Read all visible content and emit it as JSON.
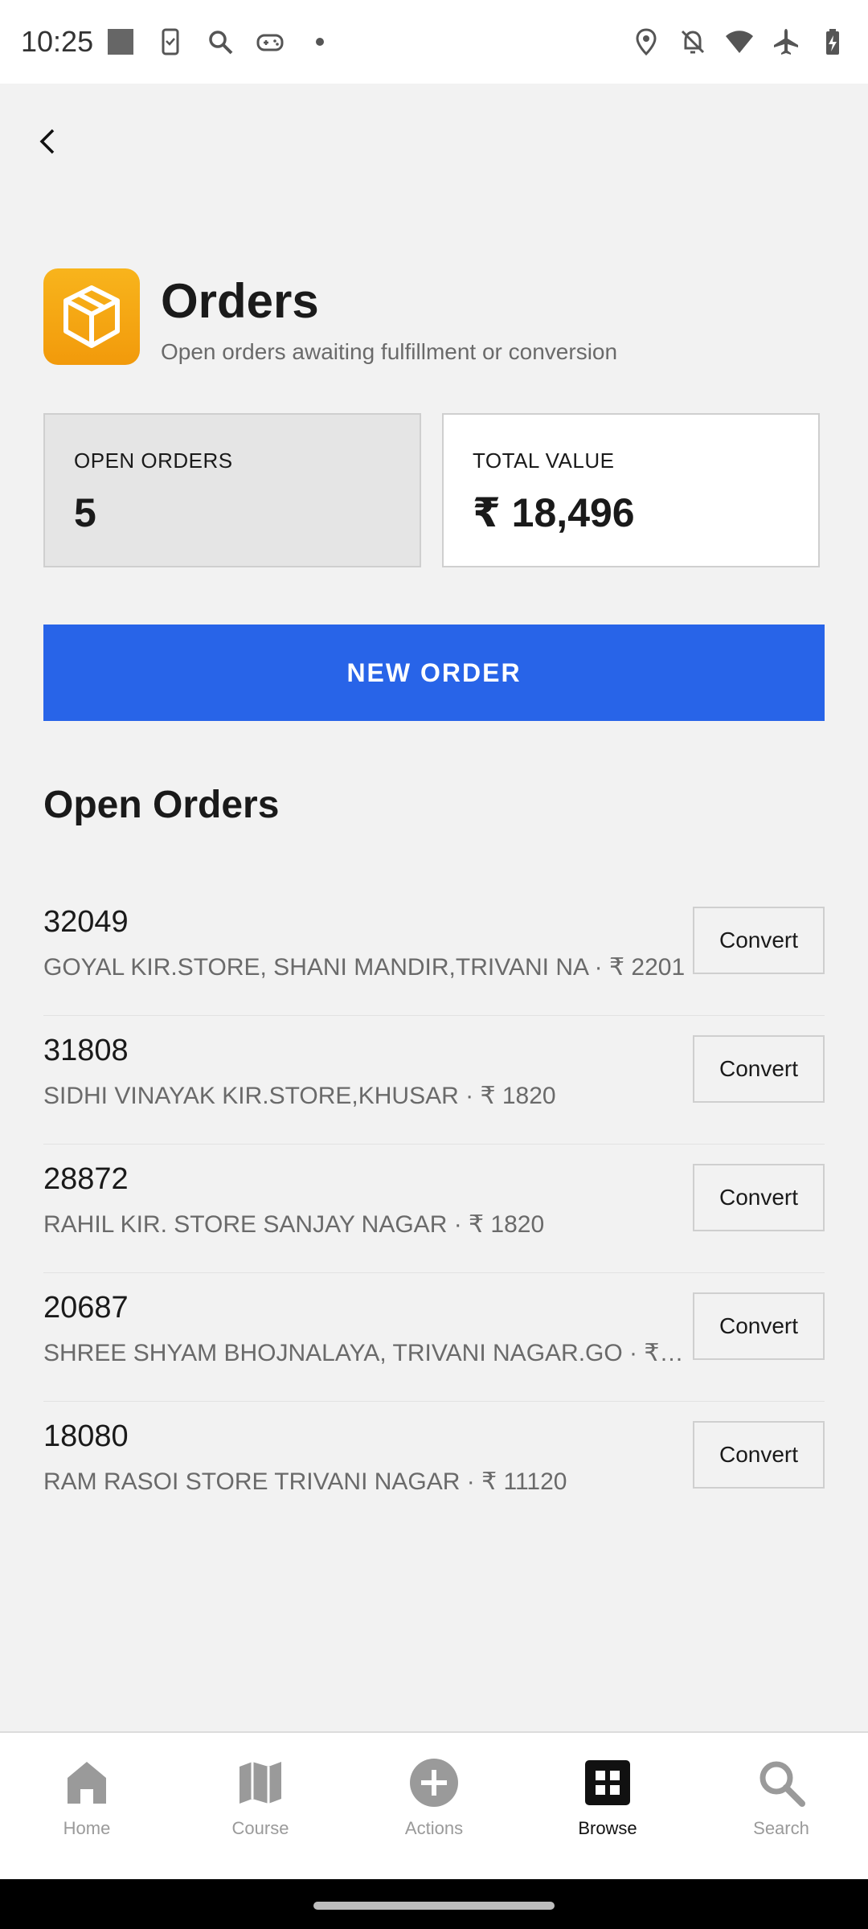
{
  "status_bar": {
    "time": "10:25"
  },
  "header": {
    "title": "Orders",
    "subtitle": "Open orders awaiting fulfillment or conversion"
  },
  "stats": {
    "open_orders_label": "OPEN ORDERS",
    "open_orders_value": "5",
    "total_value_label": "TOTAL VALUE",
    "total_value_value": "₹ 18,496"
  },
  "new_order_label": "NEW ORDER",
  "section_title": "Open Orders",
  "orders": [
    {
      "id": "32049",
      "detail": "GOYAL KIR.STORE, SHANI MANDIR,TRIVANI NA · ₹ 2201",
      "action": "Convert"
    },
    {
      "id": "31808",
      "detail": "SIDHI VINAYAK KIR.STORE,KHUSAR · ₹ 1820",
      "action": "Convert"
    },
    {
      "id": "28872",
      "detail": "RAHIL KIR. STORE SANJAY NAGAR · ₹ 1820",
      "action": "Convert"
    },
    {
      "id": "20687",
      "detail": "SHREE SHYAM BHOJNALAYA, TRIVANI NAGAR.GO · ₹ …",
      "action": "Convert"
    },
    {
      "id": "18080",
      "detail": "RAM RASOI STORE TRIVANI NAGAR · ₹ 11120",
      "action": "Convert"
    }
  ],
  "bottom_nav": [
    {
      "label": "Home",
      "icon": "home-icon"
    },
    {
      "label": "Course",
      "icon": "map-icon"
    },
    {
      "label": "Actions",
      "icon": "add-circle-icon"
    },
    {
      "label": "Browse",
      "icon": "grid-icon",
      "active": true
    },
    {
      "label": "Search",
      "icon": "search-icon"
    }
  ],
  "colors": {
    "accent": "#2864e8",
    "app_icon": "#f5a623",
    "active_nav": "#111111",
    "inactive_nav": "#9a9a9a"
  }
}
